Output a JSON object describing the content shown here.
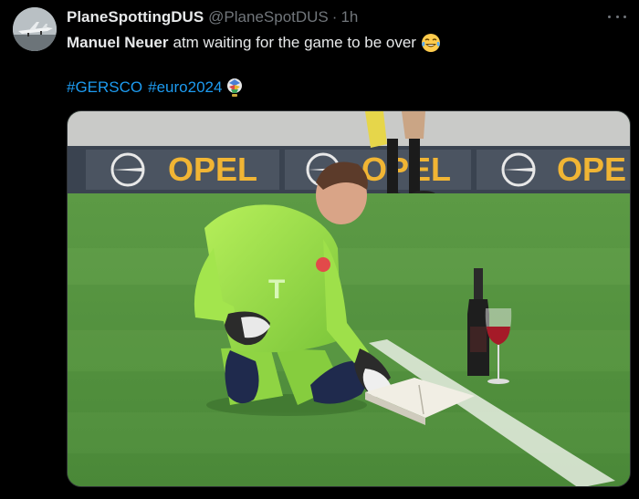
{
  "tweet": {
    "display_name": "PlaneSpottingDUS",
    "handle": "@PlaneSpotDUS",
    "separator": "·",
    "time": "1h",
    "text_bold": "Manuel Neuer",
    "text_rest": "atm waiting for the game to be over",
    "text_emoji": "face-with-tears-of-joy-icon",
    "hashtags": [
      "#GERSCO",
      "#euro2024"
    ],
    "hashtag_emoji": "euro2024-trophy-icon"
  },
  "media": {
    "ad_boards": [
      "OPEL",
      "OPEL",
      "OPE"
    ]
  },
  "colors": {
    "background": "#000000",
    "text": "#e7e9ea",
    "secondary": "#71767b",
    "link": "#1d9bf0"
  }
}
